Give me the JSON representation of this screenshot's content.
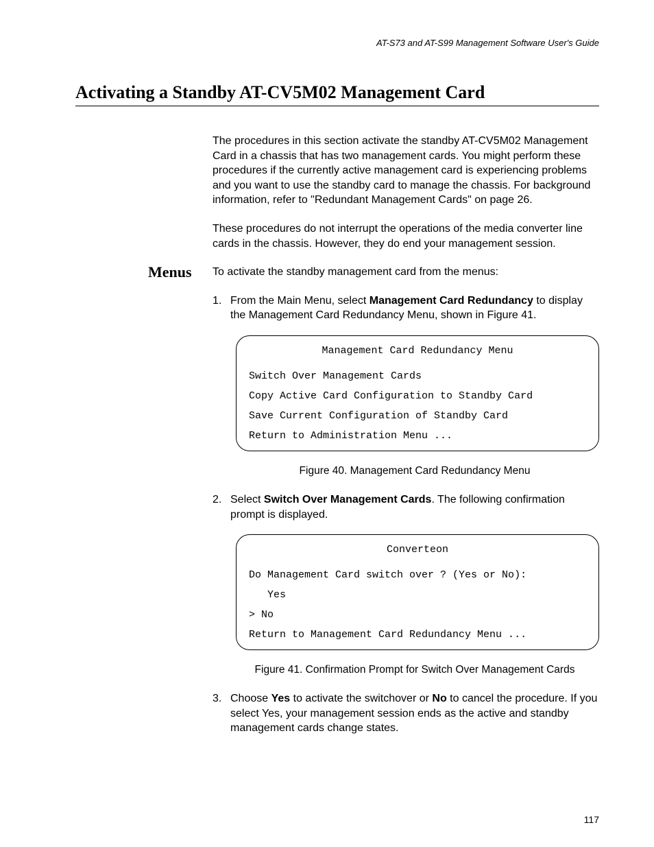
{
  "header": "AT-S73 and AT-S99 Management Software User's Guide",
  "title": "Activating a Standby AT-CV5M02 Management Card",
  "intro1": "The procedures in this section activate the standby AT-CV5M02 Management Card in a chassis that has two management cards. You might perform these procedures if the currently active management card is experiencing problems and you want to use the standby card to manage the chassis. For background information, refer to \"Redundant Management Cards\" on page 26.",
  "intro2": "These procedures do not interrupt the operations of the media converter line cards in the chassis. However, they do end your management session.",
  "sideLabel": "Menus",
  "menusLine": "To activate the standby management card from the menus:",
  "step1": {
    "num": "1.",
    "pre": "From the Main Menu, select ",
    "bold": "Management Card Redundancy",
    "post": " to display the Management Card Redundancy Menu, shown in Figure 41."
  },
  "menuBox1": {
    "title": "Management Card Redundancy Menu",
    "lines": [
      "Switch Over Management Cards",
      "Copy Active Card Configuration to Standby Card",
      "Save Current Configuration of Standby Card",
      "Return to Administration Menu ..."
    ]
  },
  "fig40": "Figure 40. Management Card Redundancy Menu",
  "step2": {
    "num": "2.",
    "pre": "Select ",
    "bold": "Switch Over Management Cards",
    "post": ". The following confirmation prompt is displayed."
  },
  "menuBox2": {
    "title": "Converteon",
    "lines": [
      "Do Management Card switch over ? (Yes or No):",
      "   Yes",
      "> No",
      "",
      "Return to Management Card Redundancy Menu ..."
    ]
  },
  "fig41": "Figure 41. Confirmation Prompt for Switch Over Management Cards",
  "step3": {
    "num": "3.",
    "pre": "Choose ",
    "bold1": "Yes",
    "mid": " to activate the switchover or ",
    "bold2": "No",
    "post": " to cancel the procedure. If you select Yes, your management session ends as the active and standby management cards change states."
  },
  "pageNum": "117"
}
